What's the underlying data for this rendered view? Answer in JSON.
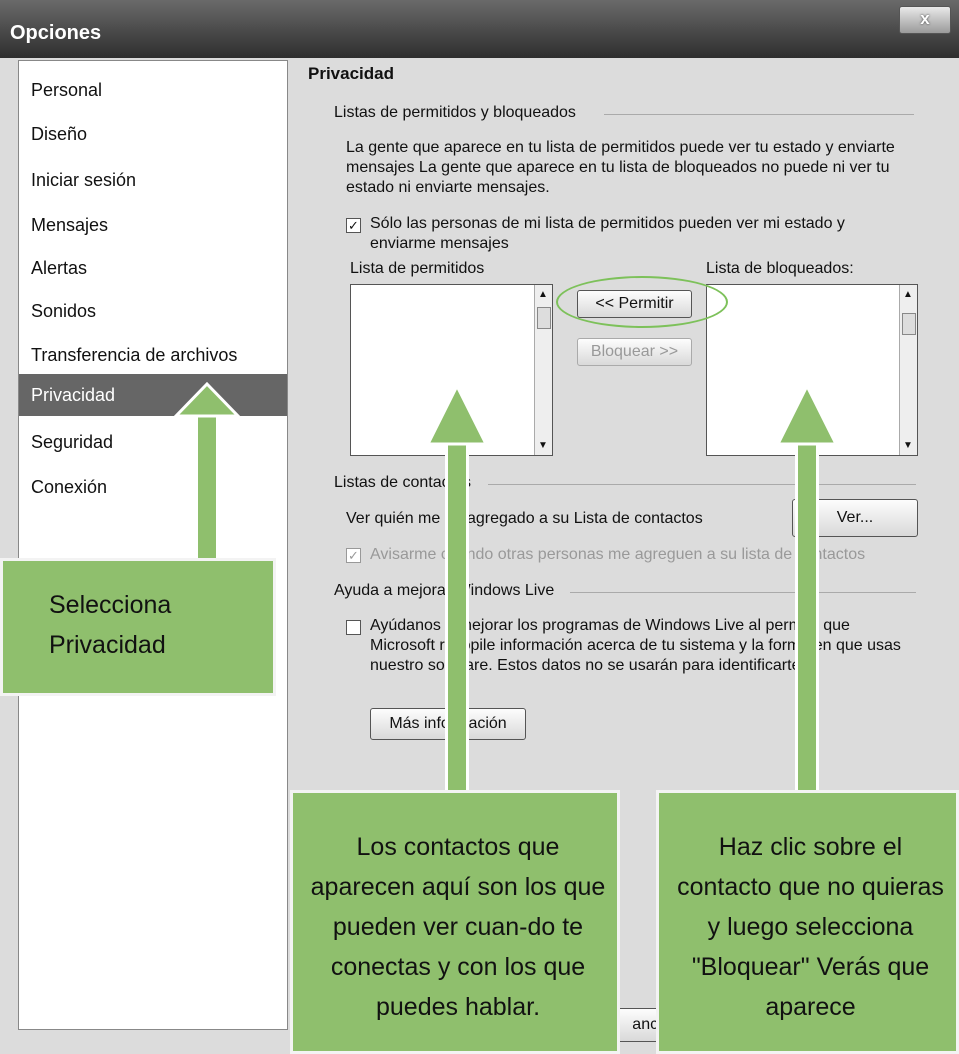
{
  "window": {
    "title": "Opciones",
    "close_label": "x"
  },
  "sidebar": {
    "items": [
      {
        "label": "Personal",
        "selected": false
      },
      {
        "label": "Diseño",
        "selected": false
      },
      {
        "label": "Iniciar sesión",
        "selected": false
      },
      {
        "label": "Mensajes",
        "selected": false
      },
      {
        "label": "Alertas",
        "selected": false
      },
      {
        "label": "Sonidos",
        "selected": false
      },
      {
        "label": "Transferencia de archivos",
        "selected": false
      },
      {
        "label": "Privacidad",
        "selected": true
      },
      {
        "label": "Seguridad",
        "selected": false
      },
      {
        "label": "Conexión",
        "selected": false
      }
    ]
  },
  "main": {
    "heading": "Privacidad",
    "lists_group": {
      "title": "Listas de permitidos y bloqueados",
      "description": "La gente que aparece en tu lista de permitidos puede ver tu estado y enviarte mensajes La gente que aparece en tu lista de bloqueados no puede ni ver tu estado ni enviarte mensajes.",
      "only_allowed_checkbox": {
        "label": "Sólo las personas de mi lista de permitidos pueden ver mi estado y enviarme mensajes",
        "checked": true
      },
      "allow_list_label": "Lista de permitidos",
      "block_list_label": "Lista de bloqueados:",
      "allow_button": "<< Permitir",
      "block_button": "Bloquear >>"
    },
    "contacts_group": {
      "title": "Listas de contactos",
      "who_added_label": "Ver quién me ha agregado a su Lista de contactos",
      "view_button": "Ver...",
      "notify_checkbox": {
        "label": "Avisarme cuando otras personas me agreguen a su lista de contactos",
        "checked": true,
        "disabled": true
      }
    },
    "improve_group": {
      "title": "Ayuda a mejorar Windows Live",
      "help_checkbox": {
        "label": "Ayúdanos a mejorar los programas de Windows Live al permitir que Microsoft recopile información acerca de tu sistema y la forma en que usas nuestro software. Estos datos no se usarán para identificarte.",
        "checked": false
      },
      "more_info_button": "Más información"
    },
    "footer_partial_button": "ance"
  },
  "callouts": {
    "privacy": "Selecciona Privacidad",
    "allowed": "Los contactos que aparecen aquí son los que pueden ver cuan-do te conectas y con los que puedes hablar.",
    "blocked": "Haz clic sobre el contacto que no quieras y luego selecciona \"Bloquear\" Verás que aparece"
  },
  "colors": {
    "callout_green": "#8fbf6d",
    "highlight_ellipse": "#7dc15a",
    "selected_item": "#666666"
  }
}
